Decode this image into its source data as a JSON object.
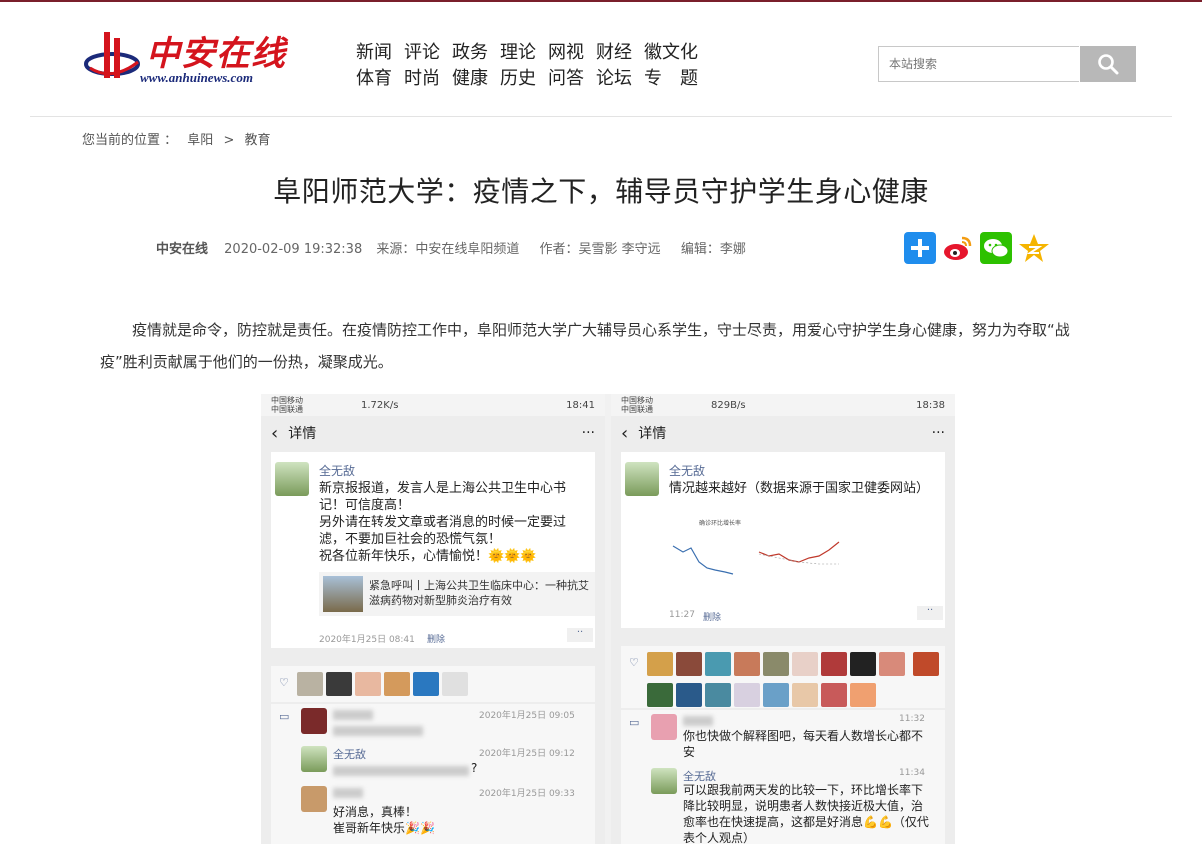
{
  "site": {
    "logo_text": "中安在线",
    "logo_url": "www.anhuinews.com"
  },
  "nav": {
    "items": [
      "新闻",
      "评论",
      "政务",
      "理论",
      "网视",
      "财经",
      "徽文化",
      "体育",
      "时尚",
      "健康",
      "历史",
      "问答",
      "论坛",
      "专　题"
    ]
  },
  "search": {
    "placeholder": "本站搜索"
  },
  "breadcrumb": {
    "label": "您当前的位置 ：",
    "level1": "阜阳",
    "sep": ">",
    "level2": "教育"
  },
  "article": {
    "title": "阜阳师范大学：疫情之下，辅导员守护学生身心健康",
    "source_name": "中安在线",
    "datetime": "2020-02-09 19:32:38",
    "source": "来源：中安在线阜阳频道",
    "author": "作者：吴雪影 李守远",
    "editor": "编辑：李娜",
    "paragraph": "疫情就是命令，防控就是责任。在疫情防控工作中，阜阳师范大学广大辅导员心系学生，守士尽责，用爱心守护学生身心健康，努力为夺取“战疫”胜利贡献属于他们的一份热，凝聚成光。"
  },
  "screenshot_left": {
    "carrier": "中国移动 中国联通",
    "speed": "1.72K/s",
    "time": "18:41",
    "title": "详情",
    "more": "···",
    "user": "全无敌",
    "text": "新京报报道，发言人是上海公共卫生中心书记！可信度高！\n另外请在转发文章或者消息的时候一定要过滤，不要加巨社会的恐慌气氛！\n祝各位新年快乐，心情愉悦！🌞🌞🌞",
    "link_text": "紧急呼叫丨上海公共卫生临床中心：一种抗艾滋病药物对新型肺炎治疗有效",
    "post_time": "2020年1月25日 08:41",
    "delete": "删除",
    "c1_time": "2020年1月25日 09:05",
    "c2_user": "全无敌",
    "c2_time": "2020年1月25日 09:12",
    "c2_text": "?",
    "c3_time": "2020年1月25日 09:33",
    "c3_text": "好消息，真棒！\n崔哥新年快乐🎉🎉"
  },
  "screenshot_right": {
    "carrier": "中国移动 中国联通",
    "speed": "829B/s",
    "time": "18:38",
    "title": "详情",
    "more": "···",
    "user": "全无敌",
    "text": "情况越来越好（数据来源于国家卫健委网站）",
    "chart_title": "确诊环比增长率",
    "post_time": "11:27",
    "delete": "删除",
    "c1_time": "11:32",
    "c1_text": "你也快做个解释图吧，每天看人数增长心都不安",
    "c2_user": "全无敌",
    "c2_time": "11:34",
    "c2_text": "可以跟我前两天发的比较一下，环比增长率下降比较明显，说明患者人数快接近极大值，治愈率也在快速提高，这都是好消息💪💪（仅代表个人观点）"
  },
  "colors": {
    "brand_red": "#d4141d",
    "brand_blue": "#1b2a7a",
    "wechat_name": "#576b95"
  }
}
